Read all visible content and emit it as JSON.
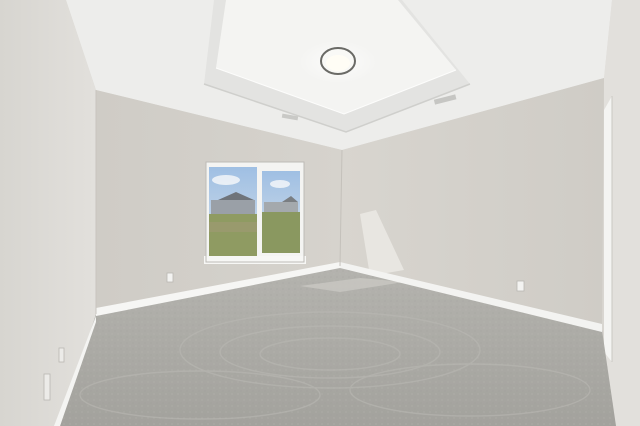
{
  "scene": {
    "kind": "empty-room-interior",
    "elements": [
      "tray-ceiling",
      "ceiling-light",
      "window",
      "carpet-floor",
      "baseboards",
      "outlets",
      "doorway"
    ]
  },
  "colors": {
    "wall_back": "#d4d1cb",
    "wall_right": "#d9d6d0",
    "wall_left": "#dcdad5",
    "ceiling": "#ececea",
    "tray": "#f2f2f0",
    "carpet": "#a9a8a3",
    "baseboard": "#f5f5f3",
    "sky": "#a9c6e6",
    "grass": "#8d9a5e"
  }
}
